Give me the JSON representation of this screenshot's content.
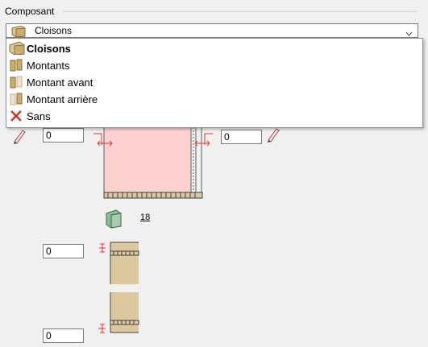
{
  "group": {
    "title": "Composant"
  },
  "combo": {
    "selected": "Cloisons",
    "icon": "cloison-icon"
  },
  "dropdown": {
    "options": [
      {
        "label": "Cloisons",
        "icon": "cloison-icon",
        "selected": true
      },
      {
        "label": "Montants",
        "icon": "montants-icon"
      },
      {
        "label": "Montant avant",
        "icon": "montant-avant-icon"
      },
      {
        "label": "Montant arrière",
        "icon": "montant-arriere-icon"
      },
      {
        "label": "Sans",
        "icon": "red-x-icon"
      }
    ]
  },
  "fields": {
    "left_offset": "0",
    "right_offset": "0",
    "top_offset": "0",
    "bottom_offset": "0"
  },
  "thickness": {
    "value": "18",
    "icon": "panel-icon"
  },
  "colors": {
    "panel_fill": "#ffd0d0",
    "wood": "#dcc79f",
    "red_dim": "#e63232",
    "accent_x": "#c0392b"
  }
}
